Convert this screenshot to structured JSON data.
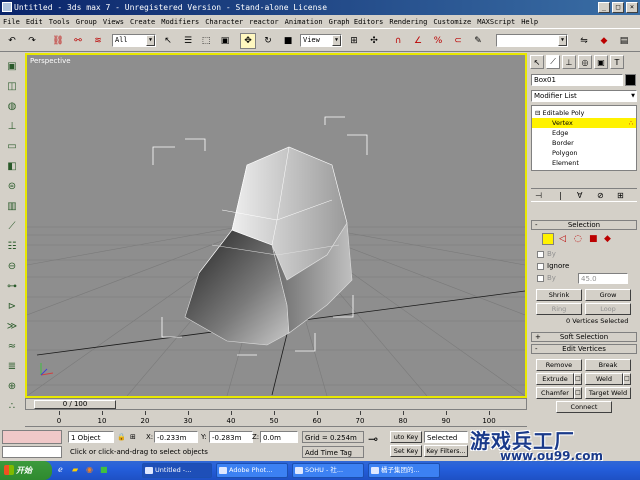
{
  "window": {
    "title": "Untitled - 3ds max 7  - Unregistered Version - Stand-alone License"
  },
  "menu": [
    "File",
    "Edit",
    "Tools",
    "Group",
    "Views",
    "Create",
    "Modifiers",
    "Character",
    "reactor",
    "Animation",
    "Graph Editors",
    "Rendering",
    "Customize",
    "MAXScript",
    "Help"
  ],
  "toolbar": {
    "selection_filter": "All",
    "reference_coord": "View",
    "named_selection": ""
  },
  "viewport": {
    "label": "Perspective"
  },
  "command_panel": {
    "object_name": "Box01",
    "modifier_list": "Modifier List",
    "stack": [
      "Editable Poly",
      "Vertex",
      "Edge",
      "Border",
      "Polygon",
      "Element"
    ],
    "selected_level": "Vertex",
    "selection_rollout": {
      "title": "Selection",
      "by_label": "By",
      "ignore_label": "Ignore",
      "by_angle_label": "By",
      "angle_value": "45.0",
      "shrink": "Shrink",
      "grow": "Grow",
      "ring": "Ring",
      "loop": "Loop",
      "status": "0 Vertices Selected"
    },
    "soft_selection_title": "Soft Selection",
    "edit_vertices": {
      "title": "Edit Vertices",
      "remove": "Remove",
      "break": "Break",
      "extrude": "Extrude",
      "weld": "Weld",
      "chamfer": "Chamfer",
      "target_weld": "Target Weld",
      "connect": "Connect"
    }
  },
  "time_slider": {
    "label": "0 / 100"
  },
  "trackbar": {
    "ticks": [
      "0",
      "10",
      "20",
      "30",
      "40",
      "50",
      "60",
      "70",
      "80",
      "90",
      "100"
    ]
  },
  "status": {
    "selection_count": "1 Object",
    "x_label": "X:",
    "x_value": "-0.233m",
    "y_label": "Y:",
    "y_value": "-0.283m",
    "z_label": "Z:",
    "z_value": "0.0m",
    "grid": "Grid = 0.254m",
    "prompt": "Click or click-and-drag to select objects",
    "add_time_tag": "Add Time Tag",
    "auto_key": "uto Key",
    "set_key": "Set Key",
    "key_mode": "Selected",
    "key_filters": "Key Filters..."
  },
  "taskbar": {
    "start": "开始",
    "tasks": [
      "Untitled -...",
      "Adobe Phot...",
      "SOHU - 社...",
      "橘子集团的..."
    ]
  },
  "colors": {
    "title_bar": "#0a246a",
    "viewport_bg": "#8e8e8e",
    "viewport_border": "#e8e800",
    "selected_stack_item": "#fff200",
    "taskbar": "#245edb",
    "start_button": "#2f8a2f"
  },
  "watermark": {
    "logo": "游戏兵工厂",
    "url": "www.ou99.com"
  }
}
